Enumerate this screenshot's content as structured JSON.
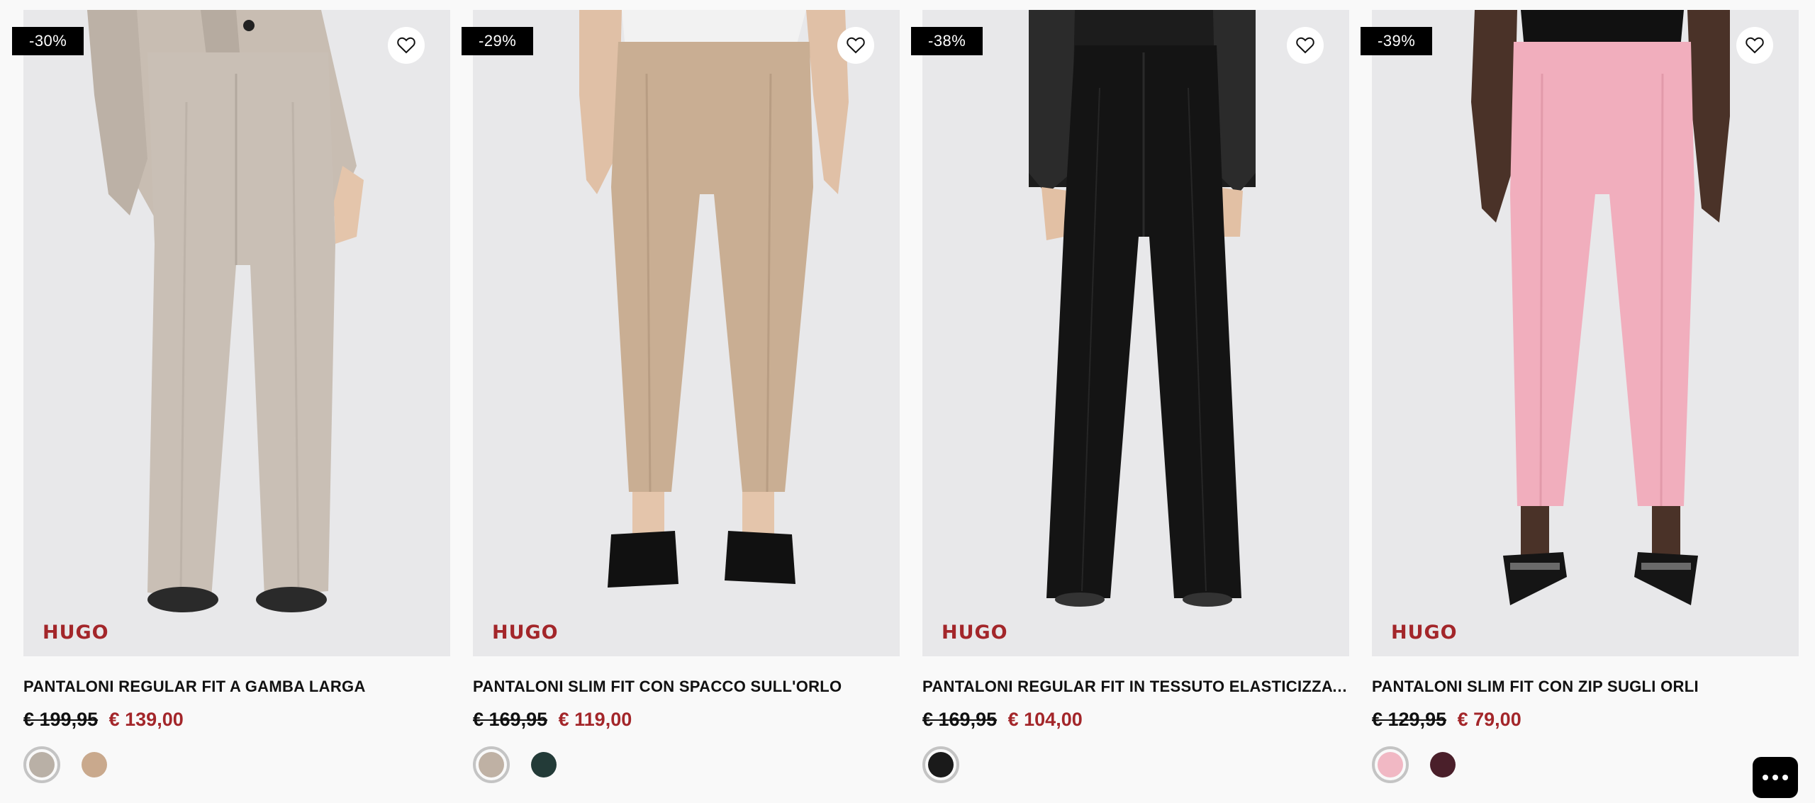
{
  "products": [
    {
      "discount": "-30%",
      "brand": "HUGO",
      "title": "PANTALONI REGULAR FIT A GAMBA LARGA",
      "old_price": "€ 199,95",
      "new_price": "€ 139,00",
      "colors": [
        "#b9b0a6",
        "#c9a98d"
      ]
    },
    {
      "discount": "-29%",
      "brand": "HUGO",
      "title": "PANTALONI SLIM FIT CON SPACCO SULL'ORLO",
      "old_price": "€ 169,95",
      "new_price": "€ 119,00",
      "colors": [
        "#bfb1a4",
        "#233b38"
      ]
    },
    {
      "discount": "-38%",
      "brand": "HUGO",
      "title": "PANTALONI REGULAR FIT IN TESSUTO ELASTICIZZATO CON CUCITURE",
      "old_price": "€ 169,95",
      "new_price": "€ 104,00",
      "colors": [
        "#1a1a1a"
      ]
    },
    {
      "discount": "-39%",
      "brand": "HUGO",
      "title": "PANTALONI SLIM FIT CON ZIP SUGLI ORLI",
      "old_price": "€ 129,95",
      "new_price": "€ 79,00",
      "colors": [
        "#f1b8c4",
        "#4a1f2a"
      ]
    }
  ],
  "colors": {
    "accent": "#a3262a",
    "badge": "#000000",
    "image_bg": "#e8e8ea",
    "page_bg": "#f9f9f9"
  },
  "icons": {
    "wishlist": "heart-outline-icon",
    "chat": "chat-dots-icon"
  }
}
